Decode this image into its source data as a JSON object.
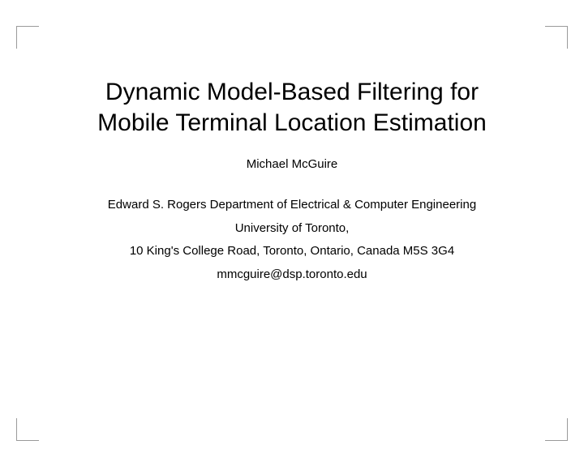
{
  "title_line1": "Dynamic Model-Based Filtering for",
  "title_line2": "Mobile Terminal Location Estimation",
  "author": "Michael McGuire",
  "affiliation": {
    "department": "Edward S. Rogers Department of Electrical & Computer Engineering",
    "university": "University of Toronto,",
    "address": "10 King's College Road, Toronto, Ontario, Canada M5S 3G4",
    "email": "mmcguire@dsp.toronto.edu"
  }
}
